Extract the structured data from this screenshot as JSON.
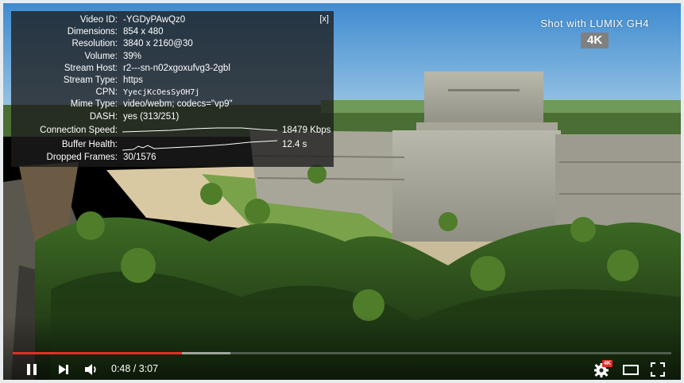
{
  "stats": {
    "close_label": "[x]",
    "rows": [
      {
        "label": "Video ID:",
        "value": "-YGDyPAwQz0"
      },
      {
        "label": "Dimensions:",
        "value": "854 x 480"
      },
      {
        "label": "Resolution:",
        "value": "3840 x 2160@30"
      },
      {
        "label": "Volume:",
        "value": "39%"
      },
      {
        "label": "Stream Host:",
        "value": "r2---sn-n02xgoxufvg3-2gbl"
      },
      {
        "label": "Stream Type:",
        "value": "https"
      },
      {
        "label": "CPN:",
        "value": "YyecjKcOesSyOH7j"
      },
      {
        "label": "Mime Type:",
        "value": "video/webm; codecs=\"vp9\""
      },
      {
        "label": "DASH:",
        "value": "yes (313/251)"
      }
    ],
    "connection_speed": {
      "label": "Connection Speed:",
      "value": "18479 Kbps"
    },
    "buffer_health": {
      "label": "Buffer Health:",
      "value": "12.4 s"
    },
    "dropped_frames": {
      "label": "Dropped Frames:",
      "value": "30/1576"
    }
  },
  "watermark": {
    "text": "Shot with LUMIX GH4",
    "badge": "4K"
  },
  "controls": {
    "time": "0:48 / 3:07",
    "played_fraction": 0.257,
    "buffered_fraction": 0.33,
    "settings_badge": "4K"
  },
  "colors": {
    "progress_played": "#e52d27",
    "badge_bg": "#e52d27",
    "overlay_bg": "rgba(28,28,28,0.78)"
  },
  "icons": {
    "play": "pause-icon",
    "next": "next-icon",
    "volume": "volume-icon",
    "settings": "gear-icon",
    "theater": "theater-icon",
    "fullscreen": "fullscreen-icon"
  }
}
